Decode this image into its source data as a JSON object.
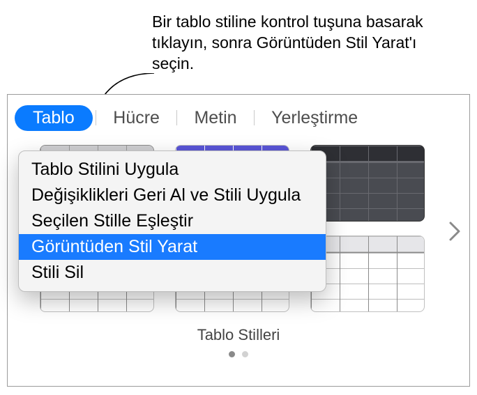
{
  "callout": {
    "text": "Bir tablo stiline kontrol tuşuna basarak tıklayın, sonra Görüntüden Stil Yarat'ı seçin."
  },
  "tabs": {
    "items": [
      "Tablo",
      "Hücre",
      "Metin",
      "Yerleştirme"
    ],
    "active_index": 0
  },
  "styles": {
    "caption": "Tablo Stilleri",
    "page_count": 2,
    "page_current": 0
  },
  "context_menu": {
    "items": [
      "Tablo Stilini Uygula",
      "Değişiklikleri Geri Al ve Stili Uygula",
      "Seçilen Stille Eşleştir",
      "Görüntüden Stil Yarat",
      "Stili Sil"
    ],
    "highlight_index": 3
  }
}
